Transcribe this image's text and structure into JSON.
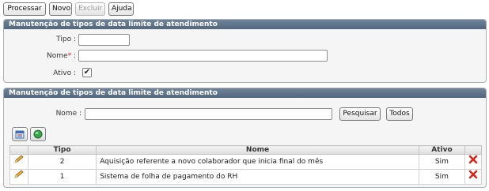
{
  "toolbar": {
    "processar": "Processar",
    "novo": "Novo",
    "excluir": "Excluir",
    "ajuda": "Ajuda"
  },
  "form_panel": {
    "title": "Manutenção de tipos de data limite de atendimento",
    "tipo_label": "Tipo :",
    "tipo_value": "",
    "nome_label": "Nome",
    "nome_required_mark": "*",
    "nome_colon": ":",
    "nome_value": "",
    "ativo_label": "Ativo :",
    "ativo_checked": true
  },
  "search_panel": {
    "title": "Manutenção de tipos de data limite de atendimento",
    "nome_label": "Nome :",
    "nome_value": "",
    "pesquisar": "Pesquisar",
    "todos": "Todos",
    "icons": [
      "export-icon",
      "refresh-globe-icon"
    ]
  },
  "table": {
    "columns": [
      "Tipo",
      "Nome",
      "Ativo"
    ],
    "rows": [
      {
        "tipo": "2",
        "nome": "Aquisição referente a novo colaborador que inicia final do mês",
        "ativo": "Sim"
      },
      {
        "tipo": "1",
        "nome": "Sistema de folha de pagamento do RH",
        "ativo": "Sim"
      }
    ]
  },
  "colors": {
    "header_bar": "#5f7389",
    "delete_red": "#d9261c",
    "edit_pencil": "#e2a52a"
  }
}
